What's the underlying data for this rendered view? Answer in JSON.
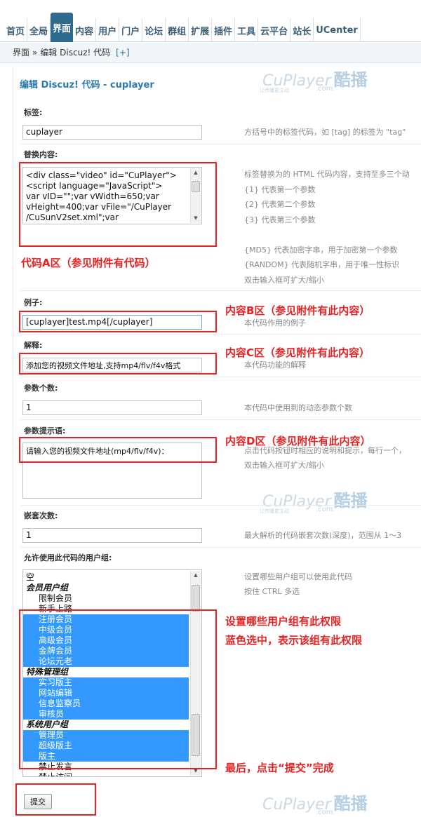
{
  "nav": {
    "tabs": [
      "首页",
      "全局",
      "界面",
      "内容",
      "用户",
      "门户",
      "论坛",
      "群组",
      "扩展",
      "插件",
      "工具",
      "云平台",
      "站长",
      "UCenter"
    ],
    "active_index": 2
  },
  "breadcrumb": {
    "root": "界面",
    "sep": "»",
    "current": "编辑 Discuz! 代码",
    "plus": "[+]"
  },
  "page_title": "编辑 Discuz! 代码 - cuplayer",
  "watermark": {
    "brand": "CuPlayer",
    "brand_cn": "酷播",
    "dot_com": ".com",
    "slogan": "让传播更主动"
  },
  "form": {
    "tag": {
      "label": "标签:",
      "value": "cuplayer",
      "hint": "方括号中的标签代码，如 [tag] 的标签为 \"tag\""
    },
    "replace": {
      "label": "替换内容:",
      "lines": [
        "<div class=\"video\" id=\"CuPlayer\">",
        "<script language=\"JavaScript\">",
        "var vID=\"\";var vWidth=650;var",
        "vHeight=400;var vFile=\"/CuPlayer",
        "/CuSunV2set.xml\";var"
      ],
      "hints": [
        "标签替换为的 HTML 代码内容，支持至多三个动",
        "{1} 代表第一个参数",
        "{2} 代表第二个参数",
        "{3} 代表第三个参数",
        "",
        "{MD5} 代表加密字串，用于加密第一个参数",
        "{RANDOM} 代表随机字串，用于唯一性标识",
        "双击输入框可扩大/缩小"
      ]
    },
    "example": {
      "label": "例子:",
      "value": "[cuplayer]test.mp4[/cuplayer]",
      "hint": "本代码作用的例子"
    },
    "explanation": {
      "label": "解释:",
      "value": "添加您的视频文件地址,支持mp4/flv/f4v格式",
      "hint": "本代码功能的解释"
    },
    "param_count": {
      "label": "参数个数:",
      "value": "1",
      "hint": "本代码中使用到的动态参数个数"
    },
    "param_prompt": {
      "label": "参数提示语:",
      "value": "请输入您的视频文件地址(mp4/flv/f4v)：",
      "hints": [
        "点击代码按钮时相应的说明和提示，每行一个，",
        "双击输入框可扩大/缩小"
      ]
    },
    "nest": {
      "label": "嵌套次数:",
      "value": "1",
      "hint": "最大解析的代码嵌套次数(深度)，范围从 1～3"
    },
    "groups": {
      "label": "允许使用此代码的用户组:",
      "hints": [
        "设置哪些用户组可以使用此代码",
        "按住 CTRL 多选"
      ],
      "items": [
        {
          "text": "空",
          "type": "plain",
          "selected": false
        },
        {
          "text": "会员用户组",
          "type": "group",
          "selected": false
        },
        {
          "text": "限制会员",
          "type": "opt",
          "selected": false
        },
        {
          "text": "新手上路",
          "type": "opt",
          "selected": false
        },
        {
          "text": "注册会员",
          "type": "opt",
          "selected": true
        },
        {
          "text": "中级会员",
          "type": "opt",
          "selected": true
        },
        {
          "text": "高级会员",
          "type": "opt",
          "selected": true
        },
        {
          "text": "金牌会员",
          "type": "opt",
          "selected": true
        },
        {
          "text": "论坛元老",
          "type": "opt",
          "selected": true
        },
        {
          "text": "特殊管理组",
          "type": "group",
          "selected": false
        },
        {
          "text": "实习版主",
          "type": "opt",
          "selected": true
        },
        {
          "text": "网站编辑",
          "type": "opt",
          "selected": true
        },
        {
          "text": "信息监察员",
          "type": "opt",
          "selected": true
        },
        {
          "text": "审核员",
          "type": "opt",
          "selected": true
        },
        {
          "text": "系统用户组",
          "type": "group",
          "selected": false
        },
        {
          "text": "管理员",
          "type": "opt",
          "selected": true
        },
        {
          "text": "超级版主",
          "type": "opt",
          "selected": true
        },
        {
          "text": "版主",
          "type": "opt",
          "selected": true
        },
        {
          "text": "禁止发言",
          "type": "opt",
          "selected": false
        },
        {
          "text": "禁止访问",
          "type": "opt",
          "selected": false
        }
      ]
    },
    "submit_label": "提交"
  },
  "annotations": {
    "area_a": "代码A区（参见附件有代码）",
    "area_b": "内容B区（参见附件有此内容）",
    "area_c": "内容C区（参见附件有此内容）",
    "area_d": "内容D区（参见附件有此内容）",
    "groups_1": "设置哪些用户组有此权限",
    "groups_2": "蓝色选中，表示该组有此权限",
    "final": "最后，点击“提交”完成"
  },
  "colors": {
    "nav_active": "#2f6b8f",
    "title": "#2a7ab0",
    "annotation": "#e52323",
    "selected": "#3399ff"
  }
}
